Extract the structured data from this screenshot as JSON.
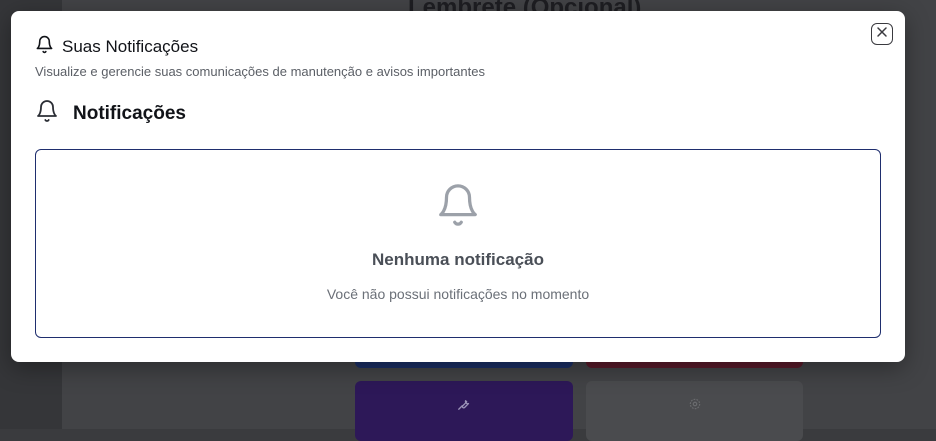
{
  "background": {
    "heading": "Lembrete (Opcional)"
  },
  "modal": {
    "title": "Suas Notificações",
    "description": "Visualize e gerencie suas comunicações de manutenção e avisos importantes",
    "section_title": "Notificações",
    "empty_title": "Nenhuma notificação",
    "empty_subtitle": "Você não possui notificações no momento",
    "icons": {
      "title": "bell-icon",
      "section": "bell-icon",
      "empty": "bell-icon",
      "close": "close-icon"
    }
  },
  "colors": {
    "card_border": "#1f2e6e",
    "text_primary": "#111318",
    "text_muted": "#6b7078"
  }
}
